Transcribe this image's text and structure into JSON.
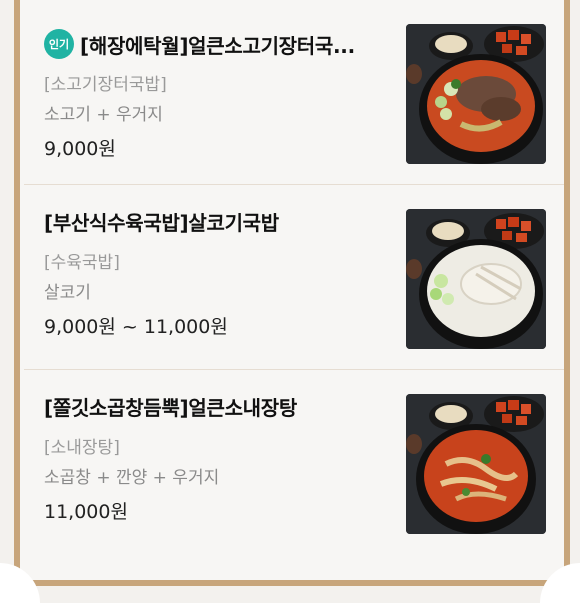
{
  "items": [
    {
      "badge": "인기",
      "title": "[해장에탁월]얼큰소고기장터국...",
      "category": "[소고기장터국밥]",
      "desc": "소고기 + 우거지",
      "price": "9,000원",
      "image_icon": "red-beef-soup-photo"
    },
    {
      "title": "[부산식수육국밥]살코기국밥",
      "category": "[수육국밥]",
      "desc": "살코기",
      "price": "9,000원 ~ 11,000원",
      "image_icon": "white-pork-soup-photo"
    },
    {
      "title": "[쫄깃소곱창듬뿍]얼큰소내장탕",
      "category": "[소내장탕]",
      "desc": "소곱창 + 깐양 + 우거지",
      "price": "11,000원",
      "image_icon": "red-tripe-soup-photo"
    }
  ],
  "colors": {
    "badge": "#20b3a3",
    "frame": "#c7a57b",
    "background": "#f7f6f4"
  }
}
